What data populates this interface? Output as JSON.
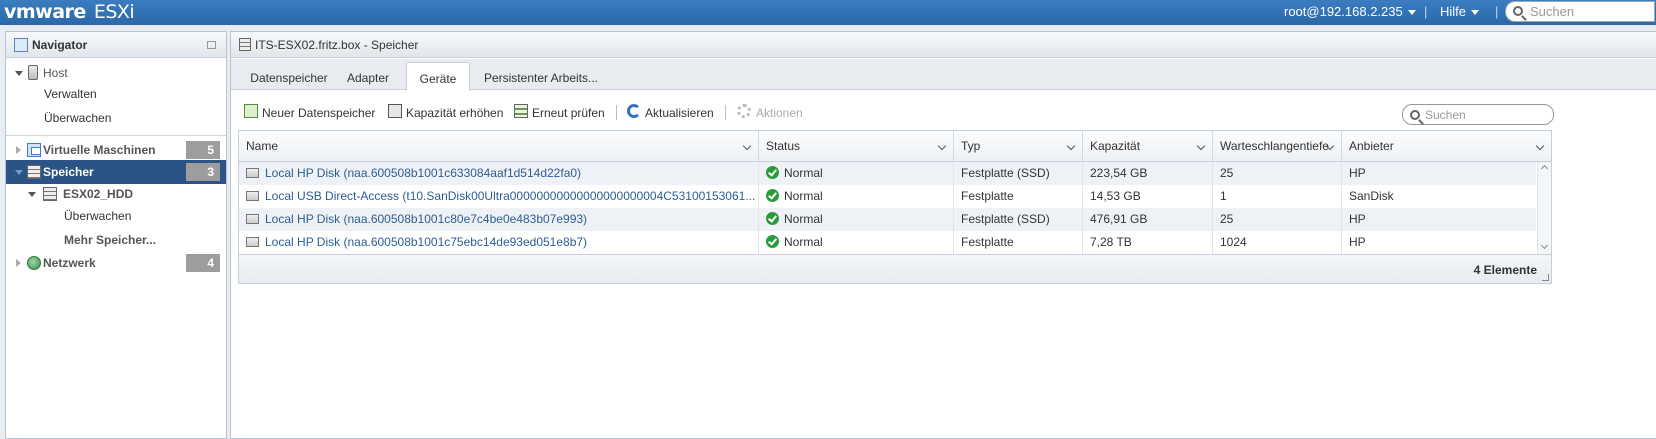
{
  "topbar": {
    "logo_vm": "vmware",
    "logo_product": "ESXi",
    "user": "root@192.168.2.235",
    "help": "Hilfe",
    "search_placeholder": "Suchen"
  },
  "navigator": {
    "title": "Navigator",
    "host": "Host",
    "manage": "Verwalten",
    "monitor": "Überwachen",
    "vms": {
      "label": "Virtuelle Maschinen",
      "count": "5"
    },
    "storage": {
      "label": "Speicher",
      "count": "3"
    },
    "datastore": "ESX02_HDD",
    "datastore_monitor": "Überwachen",
    "more_storage": "Mehr Speicher...",
    "network": {
      "label": "Netzwerk",
      "count": "4"
    }
  },
  "main": {
    "title": "ITS-ESX02.fritz.box - Speicher",
    "tabs": [
      "Datenspeicher",
      "Adapter",
      "Geräte",
      "Persistenter Arbeits..."
    ],
    "active_tab": "Geräte",
    "toolbar": {
      "new_datastore": "Neuer Datenspeicher",
      "increase_capacity": "Kapazität erhöhen",
      "rescan": "Erneut prüfen",
      "refresh": "Aktualisieren",
      "actions": "Aktionen",
      "search_placeholder": "Suchen"
    },
    "table": {
      "columns": [
        "Name",
        "Status",
        "Typ",
        "Kapazität",
        "Warteschlangentiefe",
        "Anbieter"
      ],
      "rows": [
        {
          "name": "Local HP Disk (naa.600508b1001c633084aaf1d514d22fa0)",
          "status": "Normal",
          "type": "Festplatte (SSD)",
          "capacity": "223,54 GB",
          "queue": "25",
          "vendor": "HP"
        },
        {
          "name": "Local USB Direct-Access (t10.SanDisk00Ultra00000000000000000000004C53100153061...",
          "status": "Normal",
          "type": "Festplatte",
          "capacity": "14,53 GB",
          "queue": "1",
          "vendor": "SanDisk"
        },
        {
          "name": "Local HP Disk (naa.600508b1001c80e7c4be0e483b07e993)",
          "status": "Normal",
          "type": "Festplatte (SSD)",
          "capacity": "476,91 GB",
          "queue": "25",
          "vendor": "HP"
        },
        {
          "name": "Local HP Disk (naa.600508b1001c75ebc14de93ed051e8b7)",
          "status": "Normal",
          "type": "Festplatte",
          "capacity": "7,28 TB",
          "queue": "1024",
          "vendor": "HP"
        }
      ],
      "footer": "4 Elemente"
    }
  }
}
